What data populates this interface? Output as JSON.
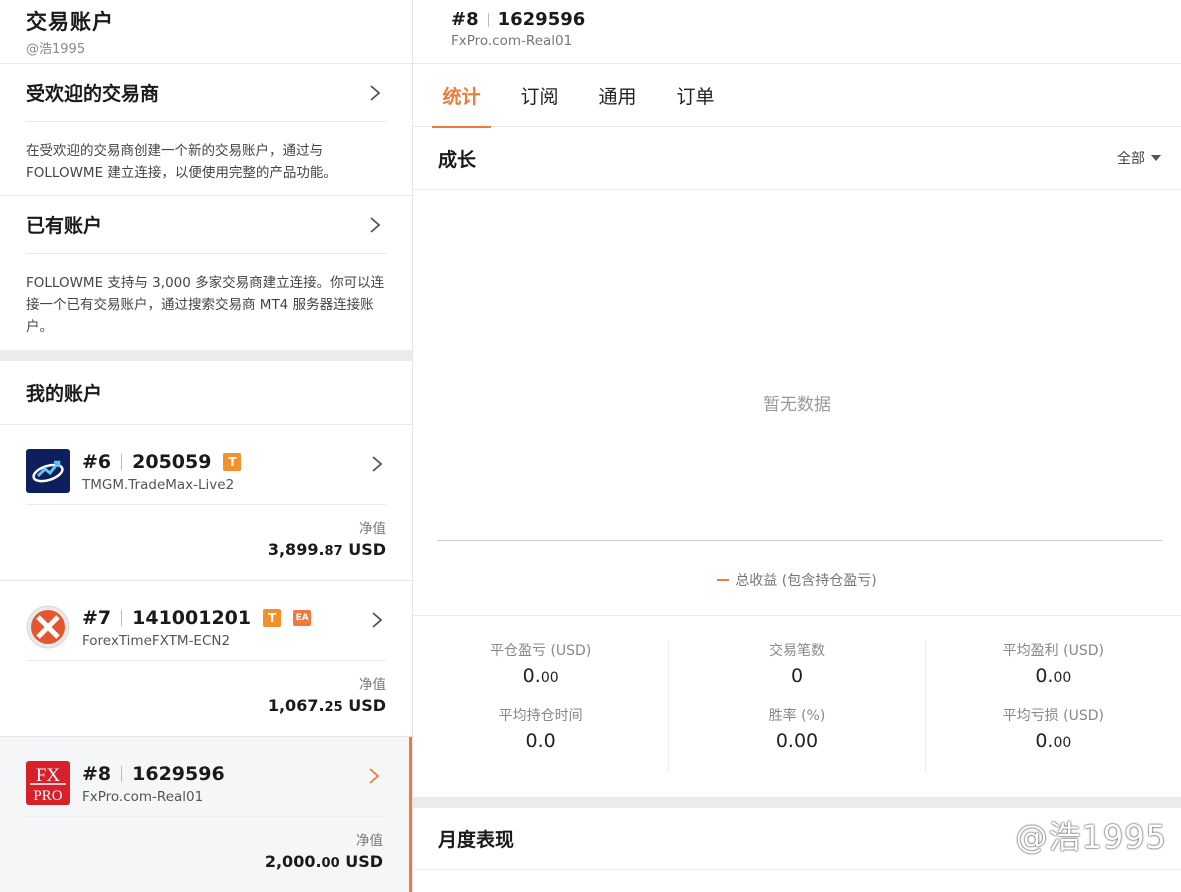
{
  "sidebar": {
    "title": "交易账户",
    "username": "@浩1995",
    "popular": {
      "heading": "受欢迎的交易商",
      "description": "在受欢迎的交易商创建一个新的交易账户，通过与 FOLLOWME 建立连接，以便使用完整的产品功能。"
    },
    "existing": {
      "heading": "已有账户",
      "description": "FOLLOWME 支持与 3,000 多家交易商建立连接。你可以连接一个已有交易账户，通过搜索交易商 MT4 服务器连接账户。"
    },
    "my_accounts_heading": "我的账户",
    "accounts": [
      {
        "index": "#6",
        "number": "205059",
        "badges": [
          "T"
        ],
        "server": "TMGM.TradeMax-Live2",
        "nav_label": "净值",
        "nav_int": "3,899.",
        "nav_dec": "87",
        "nav_ccy": " USD",
        "logo": "tmgm-logo",
        "active": false
      },
      {
        "index": "#7",
        "number": "141001201",
        "badges": [
          "T",
          "EA"
        ],
        "server": "ForexTimeFXTM-ECN2",
        "nav_label": "净值",
        "nav_int": "1,067.",
        "nav_dec": "25",
        "nav_ccy": " USD",
        "logo": "fxtm-logo",
        "active": false
      },
      {
        "index": "#8",
        "number": "1629596",
        "badges": [],
        "server": "FxPro.com-Real01",
        "nav_label": "净值",
        "nav_int": "2,000.",
        "nav_dec": "00",
        "nav_ccy": " USD",
        "logo": "fxpro-logo",
        "active": true
      }
    ]
  },
  "main": {
    "index": "#8",
    "number": "1629596",
    "server": "FxPro.com-Real01",
    "tabs": [
      {
        "label": "统计",
        "active": true
      },
      {
        "label": "订阅",
        "active": false
      },
      {
        "label": "通用",
        "active": false
      },
      {
        "label": "订单",
        "active": false
      }
    ],
    "growth": {
      "title": "成长",
      "filter": "全部",
      "empty_text": "暂无数据",
      "legend": "总收益 (包含持仓盈亏)"
    },
    "stats": [
      [
        {
          "label": "平仓盈亏 (USD)",
          "int": "0.",
          "dec": "00"
        },
        {
          "label": "平均持仓时间",
          "int": "0.0",
          "dec": ""
        }
      ],
      [
        {
          "label": "交易笔数",
          "int": "0",
          "dec": ""
        },
        {
          "label": "胜率 (%)",
          "int": "0.00",
          "dec": ""
        }
      ],
      [
        {
          "label": "平均盈利 (USD)",
          "int": "0.",
          "dec": "00"
        },
        {
          "label": "平均亏损 (USD)",
          "int": "0.",
          "dec": "00"
        }
      ]
    ],
    "monthly_title": "月度表现"
  },
  "watermark": "@浩1995",
  "colors": {
    "accent": "#f07a3c",
    "badge": "#f2902c"
  }
}
